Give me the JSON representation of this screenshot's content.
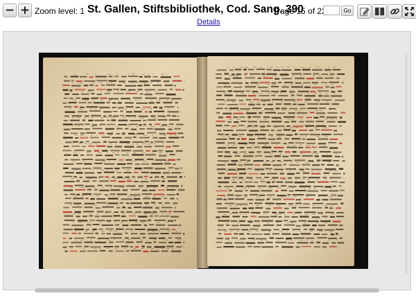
{
  "toolbar": {
    "zoom_out_symbol": "−",
    "zoom_in_symbol": "+",
    "zoom_label": "Zoom level: 1",
    "title": "St. Gallen, Stiftsbibliothek, Cod. Sang. 390",
    "page_label": "Page 15 of 220",
    "page_input_value": "",
    "go_label": "Go",
    "icons": [
      "pencil-icon",
      "two-page-icon",
      "link-icon",
      "fullscreen-icon"
    ]
  },
  "details_link": "Details",
  "viewer": {
    "content": "manuscript-double-page-scan",
    "colors": {
      "ink": "#3a2a1c",
      "rubric": "#b2322a",
      "parchment": "#e1cfaa",
      "background": "#0f0d0c"
    }
  }
}
